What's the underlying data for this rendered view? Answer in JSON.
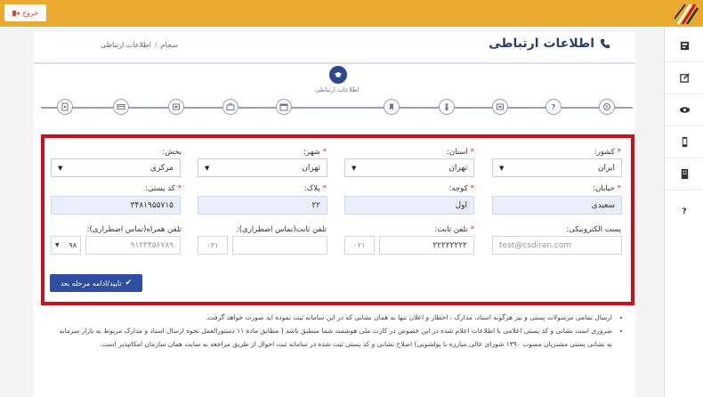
{
  "topbar": {
    "exit_label": "خروج"
  },
  "header": {
    "title": "اطلاعات ارتباطی"
  },
  "breadcrumb": {
    "home": "سجام",
    "current": "اطلاعات ارتباطی"
  },
  "stepper": {
    "active_label": "اطلاعات ارتباطی"
  },
  "form": {
    "country": {
      "label": "کشور",
      "value": "ایران"
    },
    "province": {
      "label": "استان",
      "value": "تهران"
    },
    "city": {
      "label": "شهر",
      "value": "تهران"
    },
    "district": {
      "label": "بخش",
      "value": "مرکزی"
    },
    "street": {
      "label": "خیابان",
      "value": "سعیدی"
    },
    "alley": {
      "label": "کوچه",
      "value": "اول"
    },
    "plaque": {
      "label": "پلاک",
      "value": "۲۲"
    },
    "postal_code": {
      "label": "کد پستی",
      "value": "۳۴۸۱۹۵۵۷۱۵"
    },
    "email": {
      "label": "پست الکترونیکی",
      "placeholder": "test@csdiran.com"
    },
    "landline": {
      "label": "تلفن ثابت",
      "value": "۲۲۲۲۲۲۲۲",
      "prefix": "۰۲۱"
    },
    "emergency_landline": {
      "label": "تلفن ثابت(تماس اضطراری)",
      "prefix": "۰۲۱"
    },
    "emergency_mobile": {
      "label": "تلفن همراه(تماس اضطراری)",
      "placeholder": "۹۱۲۳۴۵۶۷۸۹",
      "prefix": "۹۸"
    },
    "submit_label": "تایید/ادامه مرحله بعد"
  },
  "notes": [
    "ارسال تمامی مرسولات پستی و نیز هرگونه اسناد، مدارک ، اخطار و اعلان تنها به همان نشانی که در این سامانه ثبت نموده اید صورت خواهد گرفت.",
    "ضروری است نشانی و کد پستی اعلامی با اطلاعات اعلام شده در این خصوص در کارت ملی هوشمند شما منطبق باشد ( مطابق ماده ۱۱ دستورالعمل نحوه ارسال اسناد و مدارک مربوط به بازار سرمایه به نشانی پستی مشتریان مصوب ۱۳۹۰ شورای عالی مبارزه با پولشویی) اصلاح نشانی و کد پستی ثبت شده در سامانه ثبت احوال از طریق مراجعه به سایت همان سازمان امکانپذیر است."
  ]
}
